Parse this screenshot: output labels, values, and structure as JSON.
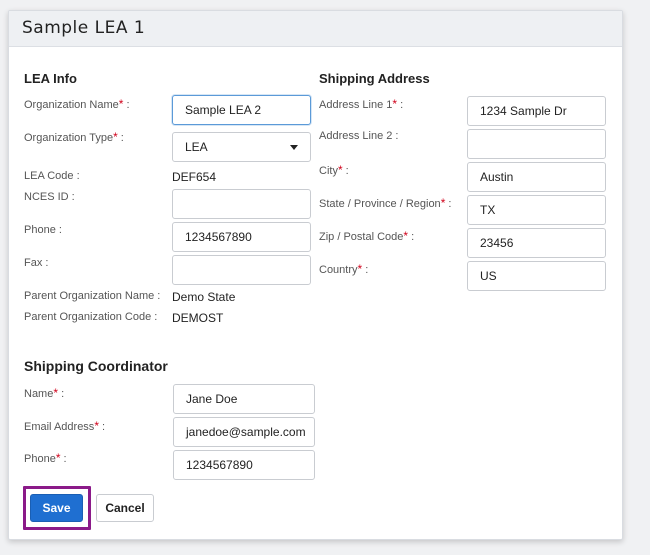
{
  "title": "Sample LEA 1",
  "lea_info": {
    "heading": "LEA Info",
    "org_name": {
      "label": "Organization Name",
      "suffix": " :",
      "value": "Sample LEA 2"
    },
    "org_type": {
      "label": "Organization Type",
      "suffix": " :",
      "value": "LEA"
    },
    "lea_code": {
      "label": "LEA Code :",
      "value": "DEF654"
    },
    "nces_id": {
      "label": "NCES ID :",
      "value": ""
    },
    "phone": {
      "label": "Phone :",
      "value": "1234567890"
    },
    "fax": {
      "label": "Fax :",
      "value": ""
    },
    "parent_name": {
      "label": "Parent Organization Name :",
      "value": "Demo State"
    },
    "parent_code": {
      "label": "Parent Organization Code :",
      "value": "DEMOST"
    }
  },
  "shipping_address": {
    "heading": "Shipping Address",
    "line1": {
      "label": "Address Line 1",
      "suffix": " :",
      "value": "1234 Sample Dr"
    },
    "line2": {
      "label": "Address Line 2 :",
      "value": ""
    },
    "city": {
      "label": "City",
      "suffix": " :",
      "value": "Austin"
    },
    "state": {
      "label": "State / Province / Region",
      "suffix": " :",
      "value": "TX"
    },
    "zip": {
      "label": "Zip / Postal Code",
      "suffix": " :",
      "value": "23456"
    },
    "country": {
      "label": "Country",
      "suffix": " :",
      "value": "US"
    }
  },
  "coordinator": {
    "heading": "Shipping Coordinator",
    "name": {
      "label": "Name",
      "suffix": " :",
      "value": "Jane Doe"
    },
    "email": {
      "label": "Email Address",
      "suffix": " :",
      "value": "janedoe@sample.com"
    },
    "phone": {
      "label": "Phone",
      "suffix": " :",
      "value": "1234567890"
    }
  },
  "required_mark": "*",
  "buttons": {
    "save": "Save",
    "cancel": "Cancel"
  },
  "colors": {
    "primary": "#1f6fd1",
    "required": "#d0021b",
    "highlight": "#8b1a89",
    "focus": "#5b9ad8"
  },
  "icons": {
    "select": "chevron-down-icon"
  }
}
